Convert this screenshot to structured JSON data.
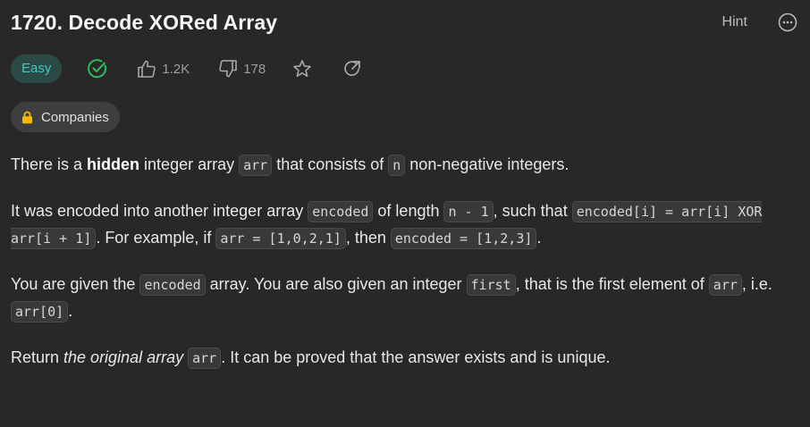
{
  "header": {
    "title": "1720. Decode XORed Array",
    "hint_label": "Hint"
  },
  "meta": {
    "difficulty": "Easy",
    "likes": "1.2K",
    "dislikes": "178"
  },
  "companies_label": "Companies",
  "description": {
    "p1": {
      "t1": "There is a ",
      "bold": "hidden",
      "t2": " integer array ",
      "c1": "arr",
      "t3": " that consists of ",
      "c2": "n",
      "t4": " non-negative integers."
    },
    "p2": {
      "t1": "It was encoded into another integer array ",
      "c1": "encoded",
      "t2": " of length ",
      "c2": "n - 1",
      "t3": ", such that ",
      "c3": "encoded[i] = arr[i] XOR arr[i + 1]",
      "t4": ". For example, if ",
      "c4": "arr = [1,0,2,1]",
      "t5": ", then ",
      "c5": "encoded = [1,2,3]",
      "t6": "."
    },
    "p3": {
      "t1": "You are given the ",
      "c1": "encoded",
      "t2": " array. You are also given an integer ",
      "c2": "first",
      "t3": ", that is the first element of ",
      "c3": "arr",
      "t4": ", i.e. ",
      "c4": "arr[0]",
      "t5": "."
    },
    "p4": {
      "t1": "Return ",
      "italic": "the original array",
      "t2": " ",
      "c1": "arr",
      "t3": ". It can be proved that the answer exists and is unique."
    }
  },
  "colors": {
    "background": "#282828",
    "easy_text": "#46c6c2",
    "easy_bg": "#2b4a46",
    "solved_green": "#2cbb5d"
  },
  "icons": [
    "more-icon",
    "solved-check-icon",
    "thumbs-up-icon",
    "thumbs-down-icon",
    "star-icon",
    "share-icon",
    "lock-icon"
  ]
}
